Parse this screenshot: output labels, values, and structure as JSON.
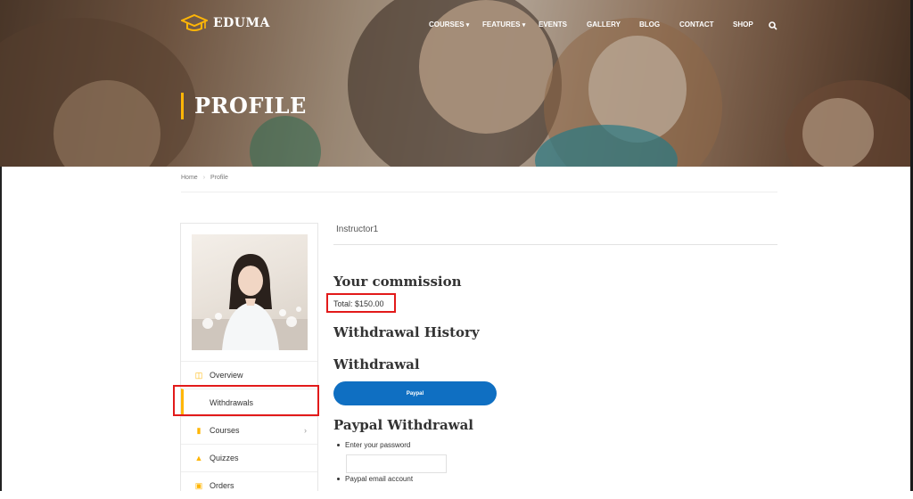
{
  "brand": {
    "name": "EDUMA",
    "icon": "graduation-cap-icon",
    "accent": "#ffb606"
  },
  "nav": {
    "items": [
      {
        "label": "COURSES",
        "has_dropdown": true
      },
      {
        "label": "FEATURES",
        "has_dropdown": true
      },
      {
        "label": "EVENTS",
        "has_dropdown": false
      },
      {
        "label": "GALLERY",
        "has_dropdown": false
      },
      {
        "label": "BLOG",
        "has_dropdown": false
      },
      {
        "label": "CONTACT",
        "has_dropdown": false
      },
      {
        "label": "SHOP",
        "has_dropdown": false
      }
    ],
    "search_icon": "search-icon"
  },
  "hero": {
    "title": "PROFILE"
  },
  "breadcrumb": {
    "home": "Home",
    "current": "Profile"
  },
  "sidebar": {
    "items": [
      {
        "label": "Overview",
        "icon": "dashboard-icon"
      },
      {
        "label": "Withdrawals",
        "icon": "",
        "active": true
      },
      {
        "label": "Courses",
        "icon": "book-icon",
        "has_submenu": true
      },
      {
        "label": "Quizzes",
        "icon": "puzzle-icon"
      },
      {
        "label": "Orders",
        "icon": "cart-icon"
      }
    ]
  },
  "main": {
    "username": "Instructor1",
    "commission_heading": "Your commission",
    "total": "Total: $150.00",
    "history_heading": "Withdrawal History",
    "withdrawal_heading": "Withdrawal",
    "paypal_button": "Paypal",
    "paypal_heading": "Paypal Withdrawal",
    "form": {
      "password_label": "Enter your password",
      "email_label": "Paypal email account"
    }
  },
  "highlight_color": "#e21a1a",
  "button_color": "#0f6fc2"
}
